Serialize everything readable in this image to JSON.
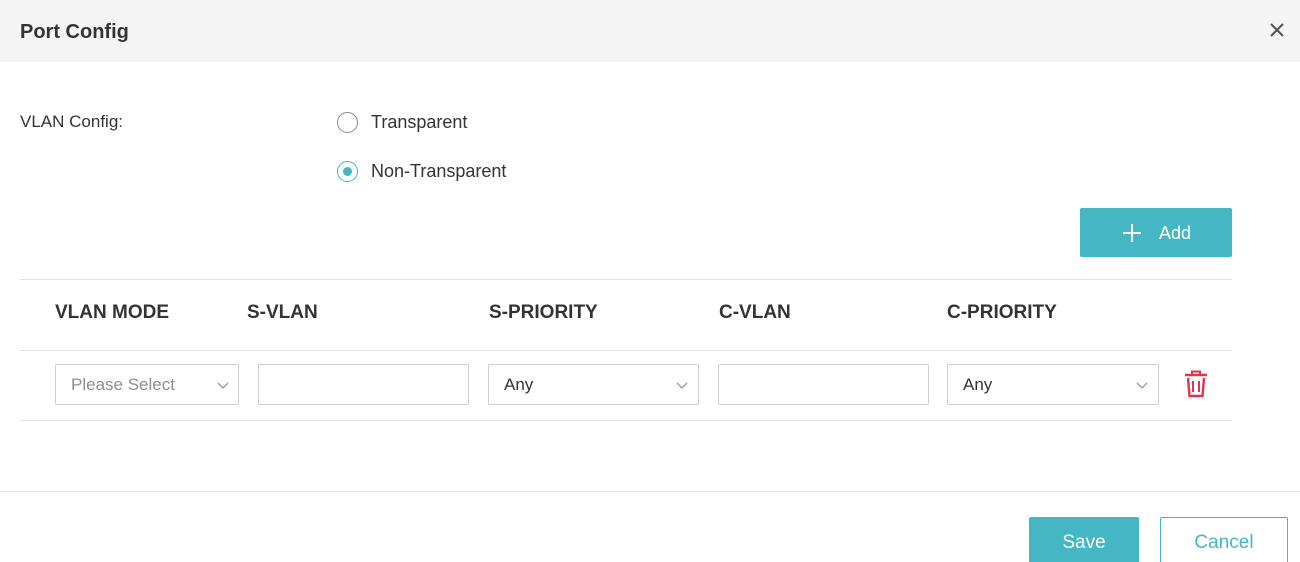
{
  "dialog": {
    "title": "Port Config",
    "close_icon": "close-icon"
  },
  "vlan_config": {
    "label": "VLAN Config:",
    "options": [
      {
        "label": "Transparent",
        "checked": false
      },
      {
        "label": "Non-Transparent",
        "checked": true
      }
    ]
  },
  "add_button": {
    "label": "Add",
    "icon": "plus-icon"
  },
  "table": {
    "headers": [
      "VLAN MODE",
      "S-VLAN",
      "S-PRIORITY",
      "C-VLAN",
      "C-PRIORITY"
    ],
    "rows": [
      {
        "vlan_mode": {
          "placeholder": "Please Select",
          "value": ""
        },
        "s_vlan": "",
        "s_priority": "Any",
        "c_vlan": "",
        "c_priority": "Any",
        "delete_icon": "trash-icon"
      }
    ]
  },
  "footer": {
    "save_label": "Save",
    "cancel_label": "Cancel"
  },
  "colors": {
    "accent": "#44b6c4",
    "delete": "#e0344c",
    "header_bg": "#f4f4f4"
  }
}
